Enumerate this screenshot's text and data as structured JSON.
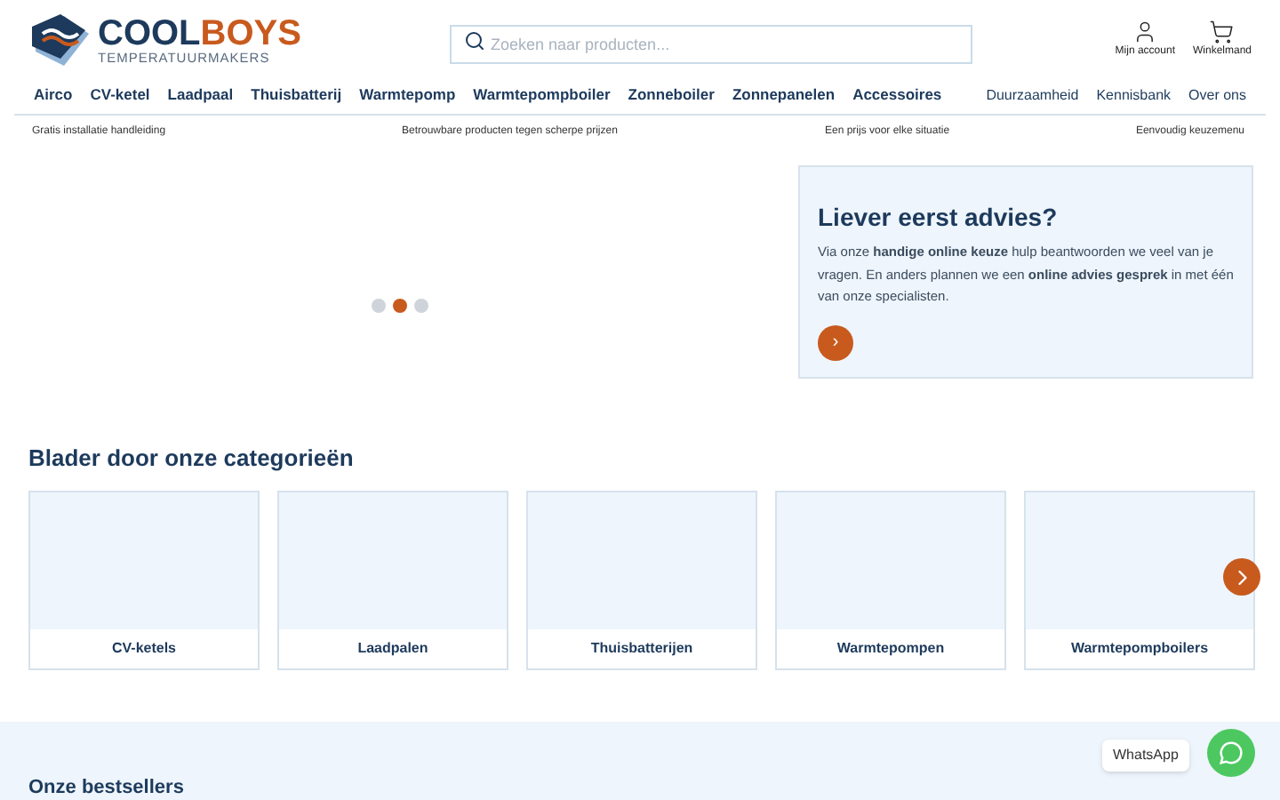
{
  "logo": {
    "word_1": "COOL",
    "word_2": "BOYS",
    "tagline": "TEMPERATUURMAKERS"
  },
  "search": {
    "placeholder": "Zoeken naar producten..."
  },
  "header_links": [
    {
      "kind": "account",
      "label": "Mijn account"
    },
    {
      "kind": "cart",
      "label": "Winkelmand"
    }
  ],
  "nav": {
    "categories": [
      "Airco",
      "CV-ketel",
      "Laadpaal",
      "Thuisbatterij",
      "Warmtepomp",
      "Warmtepompboiler",
      "Zonneboiler",
      "Zonnepanelen",
      "Accessoires"
    ],
    "pages": [
      "Duurzaamheid",
      "Kennisbank",
      "Over ons"
    ]
  },
  "usps": [
    "Gratis installatie handleiding",
    "Betrouwbare producten tegen scherpe prijzen",
    "Een prijs voor elke situatie",
    "Eenvoudig keuzemenu"
  ],
  "slider_dots": [
    {
      "selected": false
    },
    {
      "selected": true
    },
    {
      "selected": false
    }
  ],
  "advice": {
    "title": "Liever eerst advies?",
    "text": "Via onze **handige online keuze** hulp beantwoorden we veel van je vragen. En anders plannen we een **online advies gesprek** in met één van onze specialisten.",
    "button": "›"
  },
  "categories": {
    "title": "Blader door onze categorieën",
    "items": [
      "CV-ketels",
      "Laadpalen",
      "Thuisbatterijen",
      "Warmtepompen",
      "Warmtepompboilers"
    ]
  },
  "bestsellers": {
    "title": "Onze bestsellers"
  },
  "whatsapp": {
    "label": "WhatsApp"
  }
}
